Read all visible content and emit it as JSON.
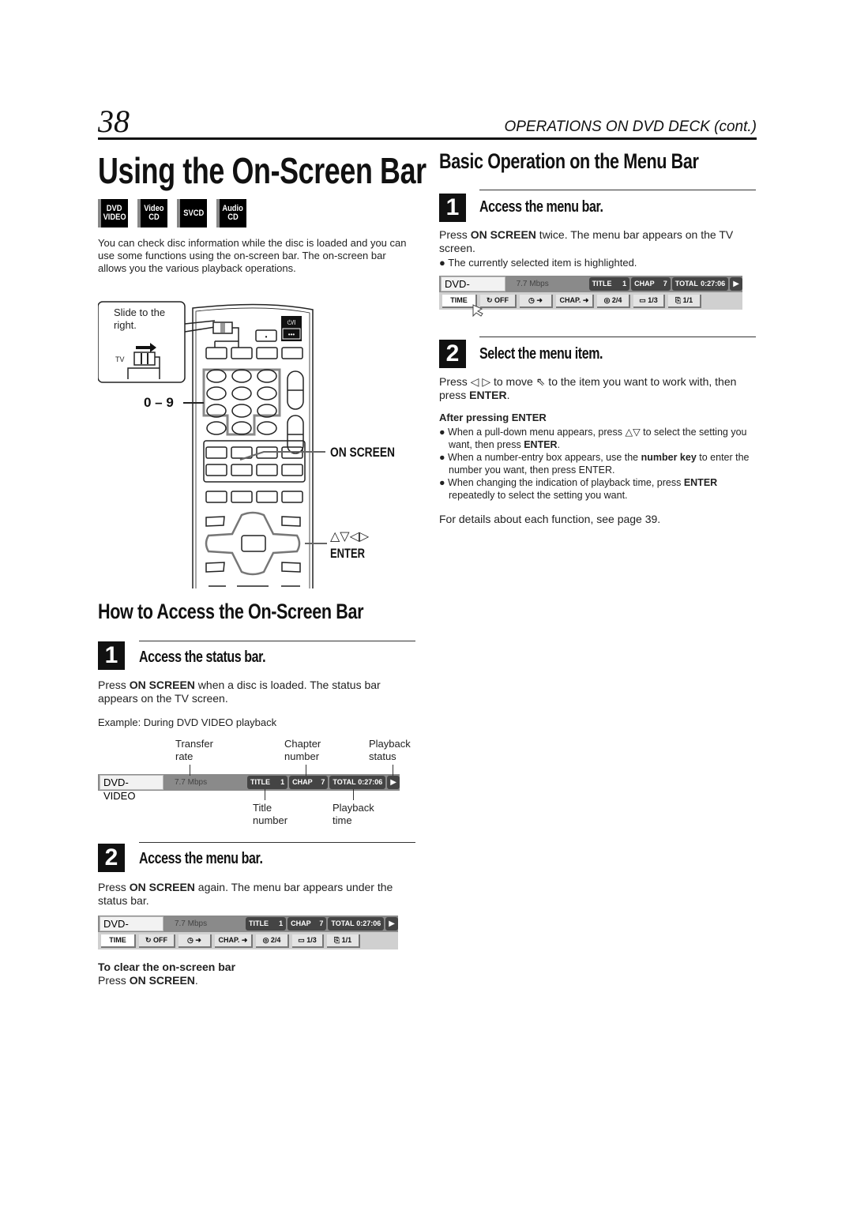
{
  "header": {
    "page_number": "38",
    "section": "OPERATIONS ON DVD DECK (cont.)"
  },
  "left": {
    "title": "Using the On-Screen Bar",
    "badges": [
      {
        "line1": "DVD",
        "line2": "VIDEO"
      },
      {
        "line1": "Video",
        "line2": "CD"
      },
      {
        "line1": "SVCD",
        "line2": ""
      },
      {
        "line1": "Audio",
        "line2": "CD"
      }
    ],
    "intro": "You can check disc information while the disc is loaded and you can use some functions using the on-screen bar. The on-screen bar allows you the various playback operations.",
    "remote": {
      "callout_slide": "Slide to the right.",
      "tv_label": "TV",
      "power_label": "⏻/I",
      "label_numbers": "0 – 9",
      "label_onscreen": "ON SCREEN",
      "label_arrows": "△▽◁▷",
      "label_enter": "ENTER"
    },
    "how_title": "How to Access the On-Screen Bar",
    "step1": {
      "number": "1",
      "title": "Access the status bar.",
      "text_pre": "Press ",
      "text_bold": "ON SCREEN",
      "text_post": " when a disc is loaded. The status bar appears on the TV screen.",
      "example": "Example: During DVD VIDEO playback",
      "callouts_top": [
        "Transfer rate",
        "Chapter number",
        "Playback status"
      ],
      "callouts_bottom": [
        "Title number",
        "Playback time"
      ]
    },
    "step2": {
      "number": "2",
      "title": "Access the menu bar.",
      "text_pre": "Press ",
      "text_bold": "ON SCREEN",
      "text_post": " again. The menu bar appears under the status bar.",
      "clear_title": "To clear the on-screen bar",
      "clear_pre": "Press ",
      "clear_bold": "ON SCREEN",
      "clear_post": "."
    }
  },
  "status_bar": {
    "disc": "DVD-VIDEO",
    "rate": "7.7 Mbps",
    "title_label": "TITLE",
    "title_value": "1",
    "chap_label": "CHAP",
    "chap_value": "7",
    "total_label": "TOTAL",
    "total_value": "0:27:06",
    "play_icon": "▶"
  },
  "menu_bar": {
    "items": [
      {
        "label": "TIME"
      },
      {
        "label": "↻ OFF"
      },
      {
        "label": "◷ ➜"
      },
      {
        "label": "CHAP. ➜"
      },
      {
        "label": "◎ 2/4"
      },
      {
        "label": "▭ 1/3"
      },
      {
        "label": "⎘ 1/1"
      }
    ]
  },
  "right": {
    "title": "Basic Operation on the Menu Bar",
    "step1": {
      "number": "1",
      "title": "Access the menu bar.",
      "text_pre": "Press ",
      "text_bold": "ON SCREEN",
      "text_post": " twice. The menu bar appears on the TV screen.",
      "bullet": "The currently selected item is highlighted."
    },
    "step2": {
      "number": "2",
      "title": "Select the menu item.",
      "text_pre": "Press ◁ ▷ to move ⇖ to the item you want to work with, then press ",
      "text_bold": "ENTER",
      "text_post": ".",
      "after_title": "After pressing ENTER",
      "bullets": [
        {
          "pre": "When a pull-down menu appears, press △▽ to select the setting you want, then press ",
          "bold": "ENTER",
          "post": "."
        },
        {
          "pre": "When a number-entry box appears, use the ",
          "bold": "number key",
          "post": " to enter the number you want, then press ENTER."
        },
        {
          "pre": "When changing the indication of playback time, press ",
          "bold": "ENTER",
          "post": " repeatedly to select the setting you want."
        }
      ],
      "details": "For details about each function, see page 39."
    }
  }
}
